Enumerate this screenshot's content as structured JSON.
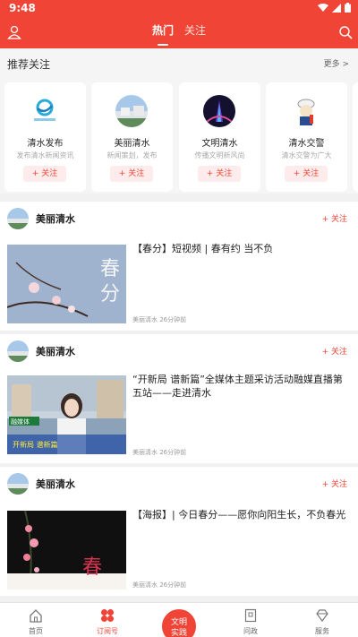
{
  "status": {
    "time": "9:48"
  },
  "header": {
    "tabs": [
      {
        "label": "热门"
      },
      {
        "label": "关注"
      }
    ]
  },
  "recommend": {
    "title": "推荐关注",
    "more": "更多 >",
    "cards": [
      {
        "name": "清水发布",
        "desc": "发布清水新闻资讯",
        "follow": "+ 关注",
        "logo_text": "清水发布"
      },
      {
        "name": "美丽清水",
        "desc": "新闻策划，发布",
        "follow": "+ 关注"
      },
      {
        "name": "文明清水",
        "desc": "传播文明新风尚",
        "follow": "+ 关注"
      },
      {
        "name": "清水交警",
        "desc": "清水交警为广大",
        "follow": "+ 关注"
      }
    ]
  },
  "feed": [
    {
      "source": "美丽清水",
      "follow": "+ 关注",
      "title": "【春分】短视频 | 春有约 当不负",
      "meta": "美丽清水  26分钟前",
      "thumb_text_1": "春",
      "thumb_text_2": "分"
    },
    {
      "source": "美丽清水",
      "follow": "+ 关注",
      "title": "“开新局 谱新篇”全媒体主题采访活动融媒直播第五站——走进清水",
      "meta": "美丽清水  26分钟前",
      "thumb_text_1": "开新局 谱新篇",
      "thumb_text_2": "融媒体"
    },
    {
      "source": "美丽清水",
      "follow": "+ 关注",
      "title": "【海报】| 今日春分——愿你向阳生长，不负春光",
      "meta": "美丽清水  26分钟前",
      "thumb_text_1": "春"
    }
  ],
  "bottom_nav": {
    "items": [
      {
        "label": "首页"
      },
      {
        "label": "订阅号"
      },
      {
        "label": "问政"
      },
      {
        "label": "服务"
      }
    ],
    "center": {
      "line1": "文明",
      "line2": "实践"
    }
  }
}
